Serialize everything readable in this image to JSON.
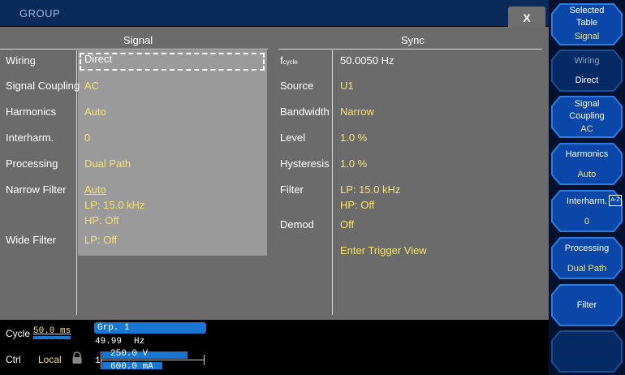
{
  "window": {
    "title": "GROUP",
    "close_label": "X"
  },
  "signal": {
    "header": "Signal",
    "rows": [
      {
        "label": "Wiring",
        "value": "Direct"
      },
      {
        "label": "Signal Coupling",
        "value": "AC"
      },
      {
        "label": "Harmonics",
        "value": "Auto"
      },
      {
        "label": "Interharm.",
        "value": "0"
      },
      {
        "label": "Processing",
        "value": "Dual Path"
      },
      {
        "label": "Narrow Filter",
        "value": "Auto",
        "value2": "LP: 15.0 kHz",
        "value3": "HP: Off"
      },
      {
        "label": "Wide Filter",
        "value": "LP: Off"
      }
    ]
  },
  "sync": {
    "header": "Sync",
    "fcycle_main": "f",
    "fcycle_sub": "cycle",
    "fcycle_value": "50.0050 Hz",
    "rows": [
      {
        "label": "Source",
        "value": "U1"
      },
      {
        "label": "Bandwidth",
        "value": "Narrow"
      },
      {
        "label": "Level",
        "value": "1.0 %"
      },
      {
        "label": "Hysteresis",
        "value": "1.0 %"
      },
      {
        "label": "Filter",
        "value": "LP: 15.0 kHz",
        "value2": "HP: Off"
      },
      {
        "label": "Demod",
        "value": "Off"
      }
    ],
    "trigger_link": "Enter Trigger View"
  },
  "status": {
    "cycle_label": "Cycle",
    "cycle_value": "50.0 ms",
    "ctrl_label": "Ctrl",
    "ctrl_value": "Local",
    "grp_label": "Grp. 1",
    "freq_value": "49.99",
    "freq_unit": "Hz",
    "channel": "1",
    "voltage": "250.0 V",
    "current": "600.0 mA"
  },
  "softkeys": [
    {
      "line1": "Selected",
      "line2": "Table",
      "value": "Signal",
      "state": "active"
    },
    {
      "line1": "Wiring",
      "line2": "",
      "value": "Direct",
      "state": "dim"
    },
    {
      "line1": "Signal",
      "line2": "Coupling",
      "value": "AC",
      "state": "active"
    },
    {
      "line1": "Harmonics",
      "line2": "",
      "value": "Auto",
      "state": "active"
    },
    {
      "line1": "Interharm.",
      "line2": "",
      "value": "0",
      "state": "active",
      "badge": "A-Z"
    },
    {
      "line1": "Processing",
      "line2": "",
      "value": "Dual Path",
      "state": "active"
    },
    {
      "line1": "Filter",
      "line2": "",
      "value": "",
      "state": "active"
    },
    {
      "line1": "",
      "line2": "",
      "value": "",
      "state": "empty"
    }
  ],
  "colors": {
    "accent_yellow": "#f1e36b",
    "title_blue": "#0a2a5c",
    "panel_gray": "#6b6b6b",
    "bar_blue": "#1976d2"
  }
}
